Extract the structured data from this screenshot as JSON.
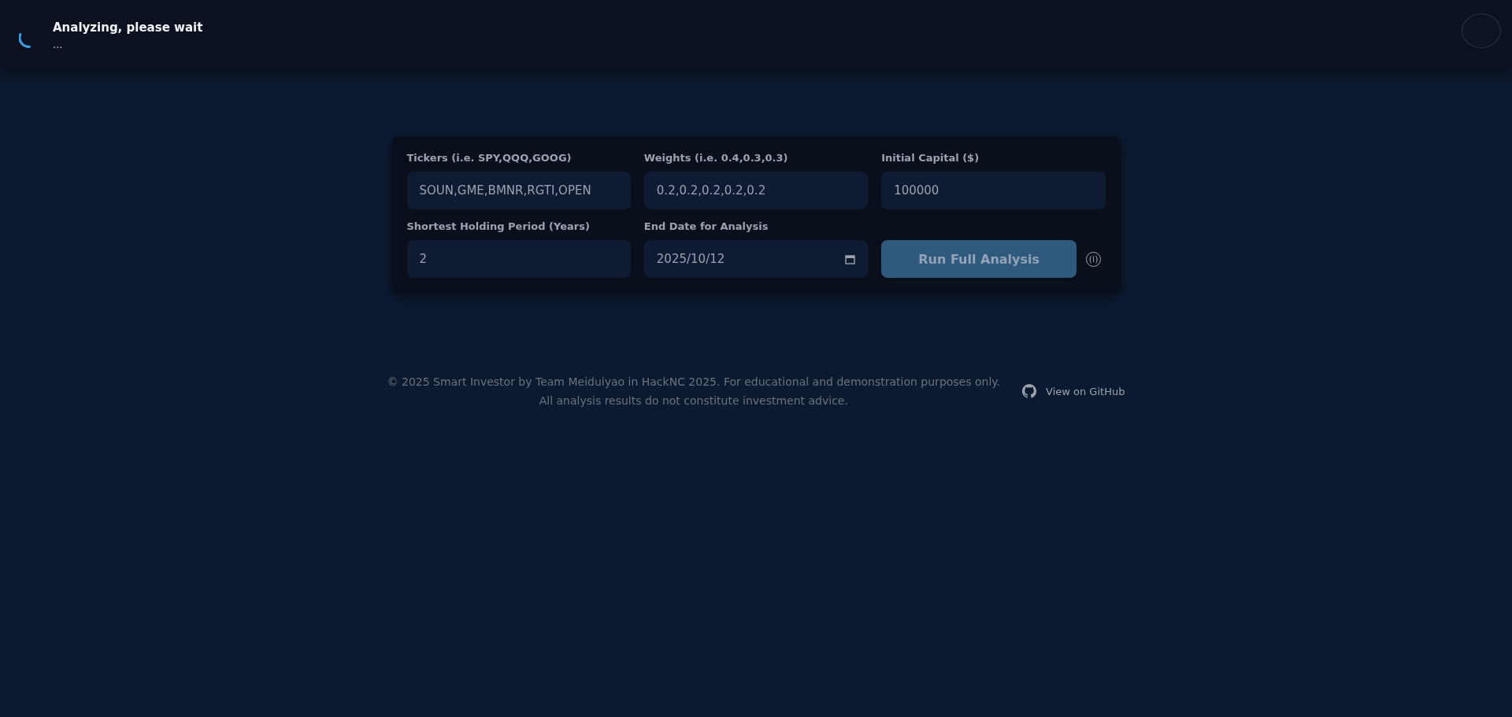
{
  "toast": {
    "title": "Analyzing, please wait",
    "message": "..."
  },
  "form": {
    "fields": [
      {
        "label": "Tickers (i.e. SPY,QQQ,GOOG)",
        "value": "SOUN,GME,BMNR,RGTI,OPEN",
        "kind": "text"
      },
      {
        "label": "Weights (i.e. 0.4,0.3,0.3)",
        "value": "0.2,0.2,0.2,0.2,0.2",
        "kind": "text"
      },
      {
        "label": "Initial Capital ($)",
        "value": "100000",
        "kind": "text"
      },
      {
        "label": "Shortest Holding Period (Years)",
        "value": "2",
        "kind": "text"
      },
      {
        "label": "End Date for Analysis",
        "value": "2025/10/12",
        "kind": "date"
      }
    ],
    "run_button": {
      "label": "Run Full Analysis",
      "disabled": true
    },
    "info_icon": "(i)"
  },
  "footer": {
    "lines": [
      "© 2025 Smart Investor by Team Meiduiyao in HackNC 2025. For educational and demonstration purposes only.",
      "All analysis results do not constitute investment advice."
    ],
    "github_link": "View on GitHub"
  }
}
